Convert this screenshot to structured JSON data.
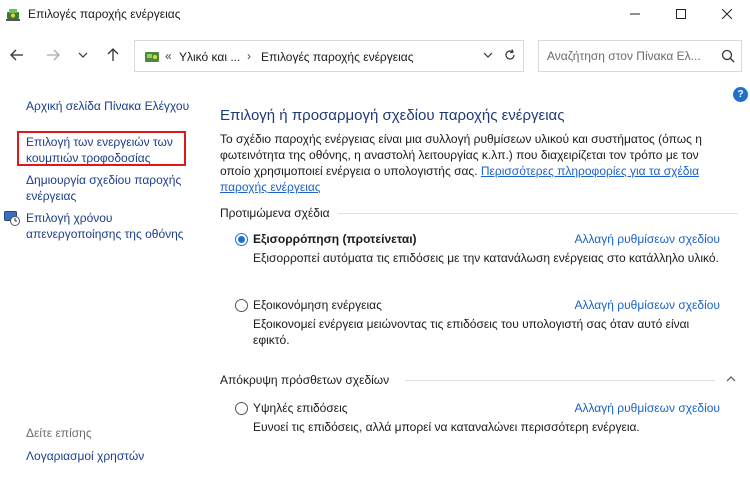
{
  "window": {
    "title": "Επιλογές παροχής ενέργειας"
  },
  "address": {
    "crumb1": "Υλικό και ...",
    "crumb2": "Επιλογές παροχής ενέργειας",
    "prefix": "«",
    "separator": "›"
  },
  "search": {
    "placeholder": "Αναζήτηση στον Πίνακα Ελ..."
  },
  "help": {
    "label": "?"
  },
  "sidebar": {
    "home": "Αρχική σελίδα Πίνακα Ελέγχου",
    "power_buttons": "Επιλογή των ενεργειών των κουμπιών τροφοδοσίας",
    "create_plan": "Δημιουργία σχεδίου παροχής ενέργειας",
    "display_off": "Επιλογή χρόνου απενεργοποίησης της οθόνης",
    "see_also": "Δείτε επίσης",
    "user_accounts": "Λογαριασμοί χρηστών"
  },
  "main": {
    "title": "Επιλογή ή προσαρμογή σχεδίου παροχής ενέργειας",
    "description": "Το σχέδιο παροχής ενέργειας είναι μια συλλογή ρυθμίσεων υλικού και συστήματος (όπως η φωτεινότητα της οθόνης, η αναστολή λειτουργίας κ.λπ.) που διαχειρίζεται τον τρόπο με τον οποίο χρησιμοποιεί ενέργεια ο υπολογιστής σας.",
    "more_link": "Περισσότερες πληροφορίες για τα σχέδια παροχής ενέργειας",
    "preferred_header": "Προτιμώμενα σχέδια",
    "hidden_header": "Απόκρυψη πρόσθετων σχεδίων",
    "plans": [
      {
        "name": "Εξισορρόπηση (προτείνεται)",
        "change": "Αλλαγή ρυθμίσεων σχεδίου",
        "description": "Εξισορροπεί αυτόματα τις επιδόσεις με την κατανάλωση ενέργειας στο κατάλληλο υλικό.",
        "selected": true
      },
      {
        "name": "Εξοικονόμηση ενέργειας",
        "change": "Αλλαγή ρυθμίσεων σχεδίου",
        "description": "Εξοικονομεί ενέργεια μειώνοντας τις επιδόσεις του υπολογιστή σας όταν αυτό είναι εφικτό.",
        "selected": false
      },
      {
        "name": "Υψηλές επιδόσεις",
        "change": "Αλλαγή ρυθμίσεων σχεδίου",
        "description": "Ευνοεί τις επιδόσεις, αλλά μπορεί να καταναλώνει περισσότερη ενέργεια.",
        "selected": false
      }
    ]
  },
  "colors": {
    "link": "#1c3d8c",
    "accent": "#1f6fd1",
    "title": "#1f3a7a",
    "highlight": "#e01818"
  }
}
